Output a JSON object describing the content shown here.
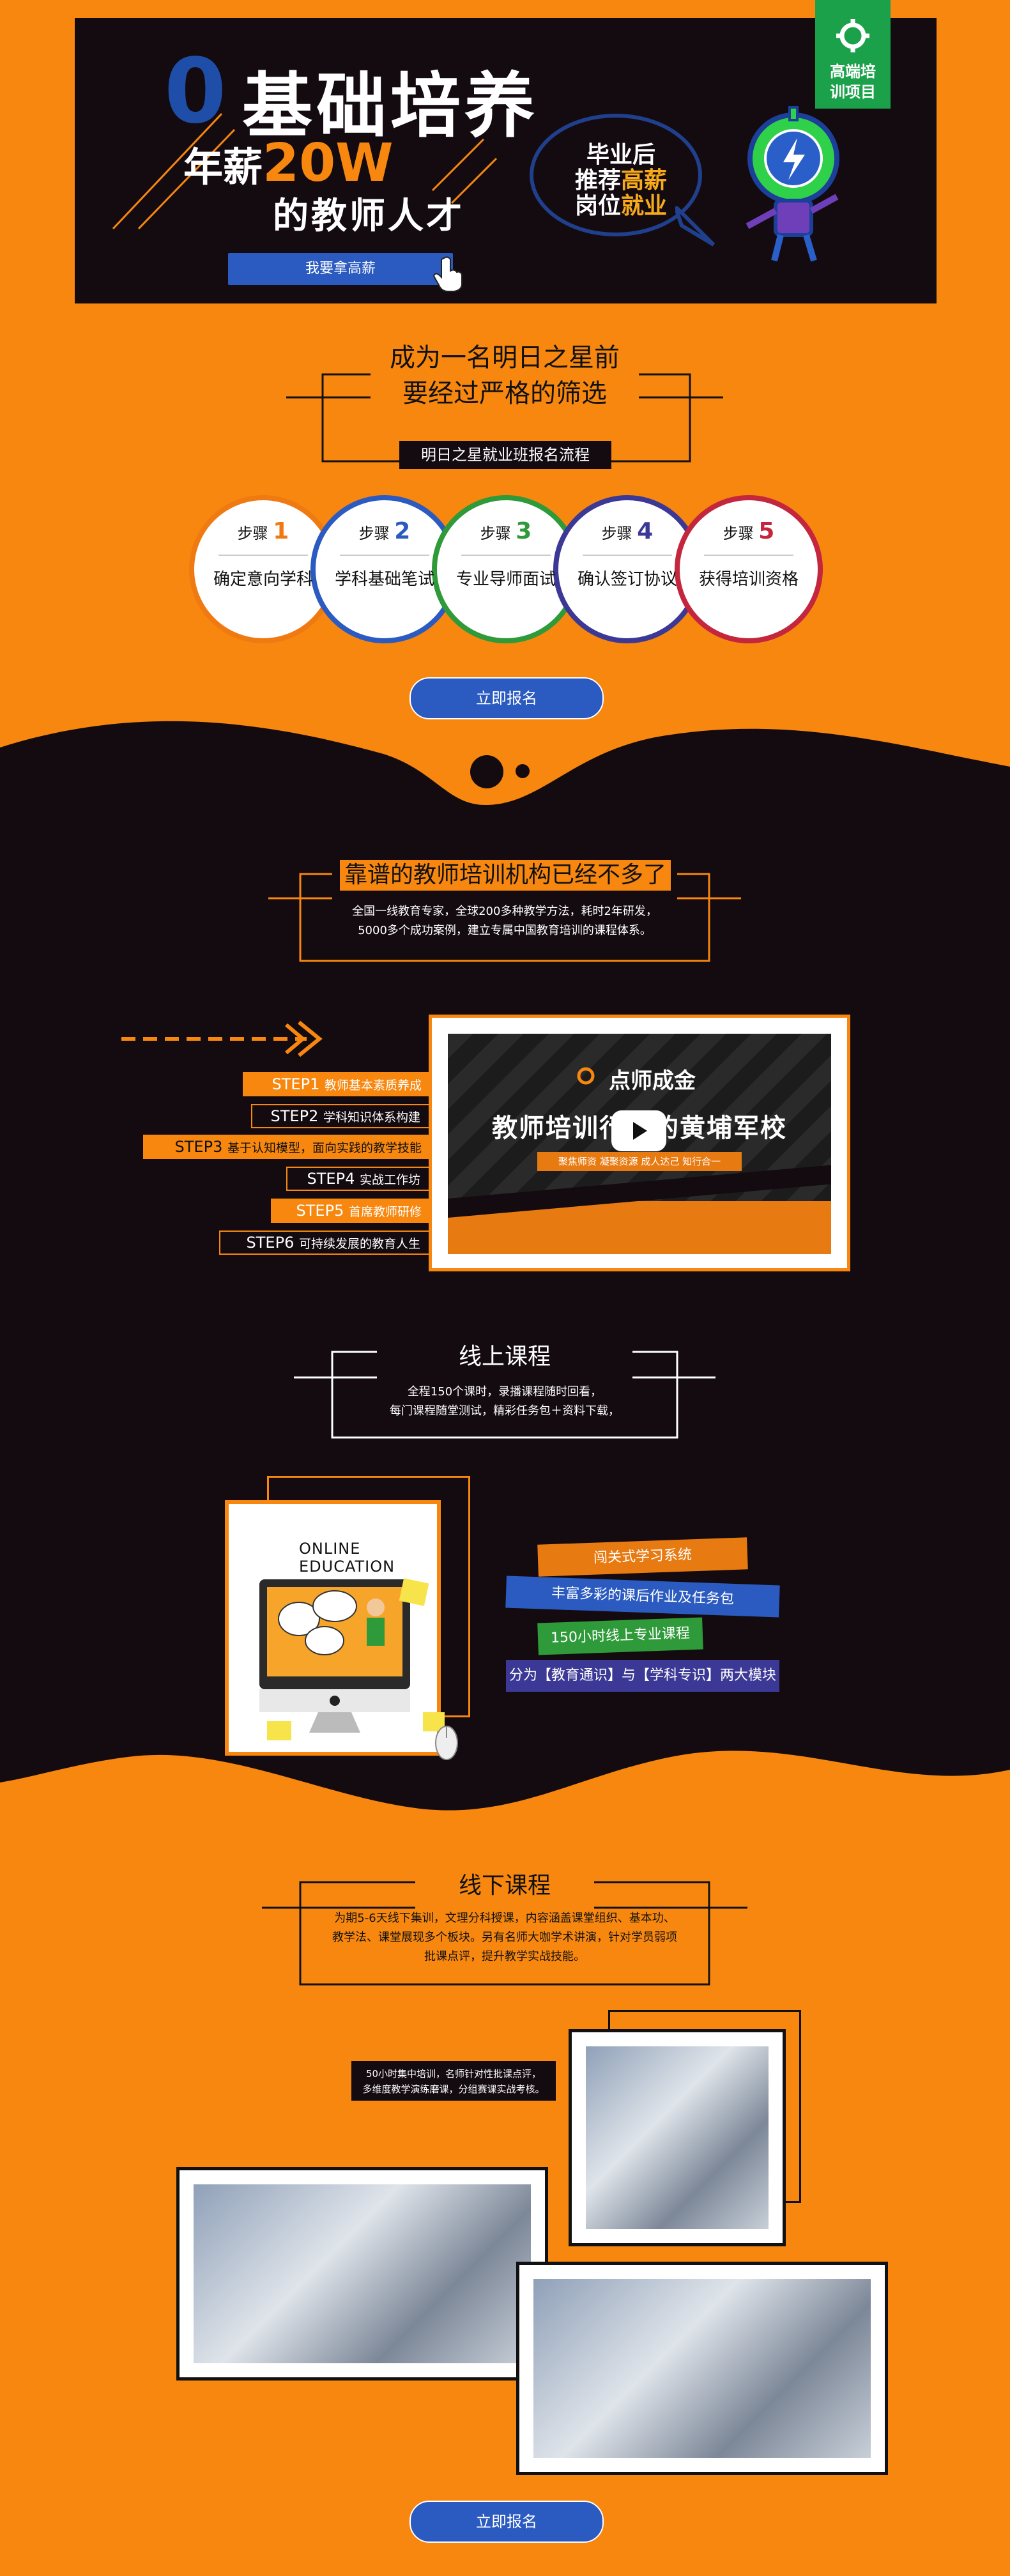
{
  "banner": {
    "zero": "0",
    "title": "基础培养",
    "salary_prefix": "年薪",
    "salary_value": "20W",
    "subtitle": "的教师人才",
    "cta": "我要拿高薪",
    "badge": "高端培训项目",
    "bubble_line1": "毕业后",
    "bubble_line2a": "推荐",
    "bubble_line2b": "高薪",
    "bubble_line3a": "岗位",
    "bubble_line3b": "就业",
    "colors": {
      "accent": "#f7870f",
      "blue": "#2b5bc0",
      "green": "#1aa14a",
      "dark": "#140b10"
    }
  },
  "process": {
    "title_line1": "成为一名明日之星前",
    "title_line2": "要经过严格的筛选",
    "subtitle": "明日之星就业班报名流程",
    "steps": [
      {
        "label": "步骤",
        "num": "1",
        "name": "确定意向学科",
        "color": "#f07a12"
      },
      {
        "label": "步骤",
        "num": "2",
        "name": "学科基础笔试",
        "color": "#2b5bc0"
      },
      {
        "label": "步骤",
        "num": "3",
        "name": "专业导师面试",
        "color": "#2e9a3a"
      },
      {
        "label": "步骤",
        "num": "4",
        "name": "确认签订协议",
        "color": "#3c3996"
      },
      {
        "label": "步骤",
        "num": "5",
        "name": "获得培训资格",
        "color": "#c4263d"
      }
    ],
    "cta": "立即报名"
  },
  "institution": {
    "title": "靠谱的教师培训机构已经不多了",
    "desc_line1": "全国一线教育专家，全球200多种教学方法，耗时2年研发，",
    "desc_line2": "5000多个成功案例，建立专属中国教育培训的课程体系。",
    "steps": [
      {
        "tag": "STEP1",
        "text": "教师基本素质养成"
      },
      {
        "tag": "STEP2",
        "text": "学科知识体系构建"
      },
      {
        "tag": "STEP3",
        "text": "基于认知模型，面向实践的教学技能"
      },
      {
        "tag": "STEP4",
        "text": "实战工作坊"
      },
      {
        "tag": "STEP5",
        "text": "首席教师研修"
      },
      {
        "tag": "STEP6",
        "text": "可持续发展的教育人生"
      }
    ],
    "video": {
      "brand": "点师成金",
      "headline": "教师培训行业的黄埔军校",
      "tagline": "聚焦师资  凝聚资源  成人达己  知行合一"
    }
  },
  "online": {
    "title": "线上课程",
    "desc_line1": "全程150个课时，录播课程随时回看，",
    "desc_line2": "每门课程随堂测试，精彩任务包＋资料下载，",
    "image_caption": "ONLINE EDUCATION",
    "tags": [
      {
        "text": "闯关式学习系统",
        "color": "#e87a12"
      },
      {
        "text": "丰富多彩的课后作业及任务包",
        "color": "#2b5bc0"
      },
      {
        "text": "150小时线上专业课程",
        "color": "#2e9a3a"
      },
      {
        "text": "分为【教育通识】与【学科专识】两大模块",
        "color": "#3c3996"
      }
    ]
  },
  "offline": {
    "title": "线下课程",
    "desc_line1": "为期5-6天线下集训，文理分科授课，内容涵盖课堂组织、基本功、",
    "desc_line2": "教学法、课堂展现多个板块。另有名师大咖学术讲演，针对学员弱项",
    "desc_line3": "批课点评，提升教学实战技能。",
    "note_line1": "50小时集中培训，名师针对性批课点评，",
    "note_line2": "多维度教学演练磨课，分组赛课实战考核。",
    "cta": "立即报名"
  }
}
